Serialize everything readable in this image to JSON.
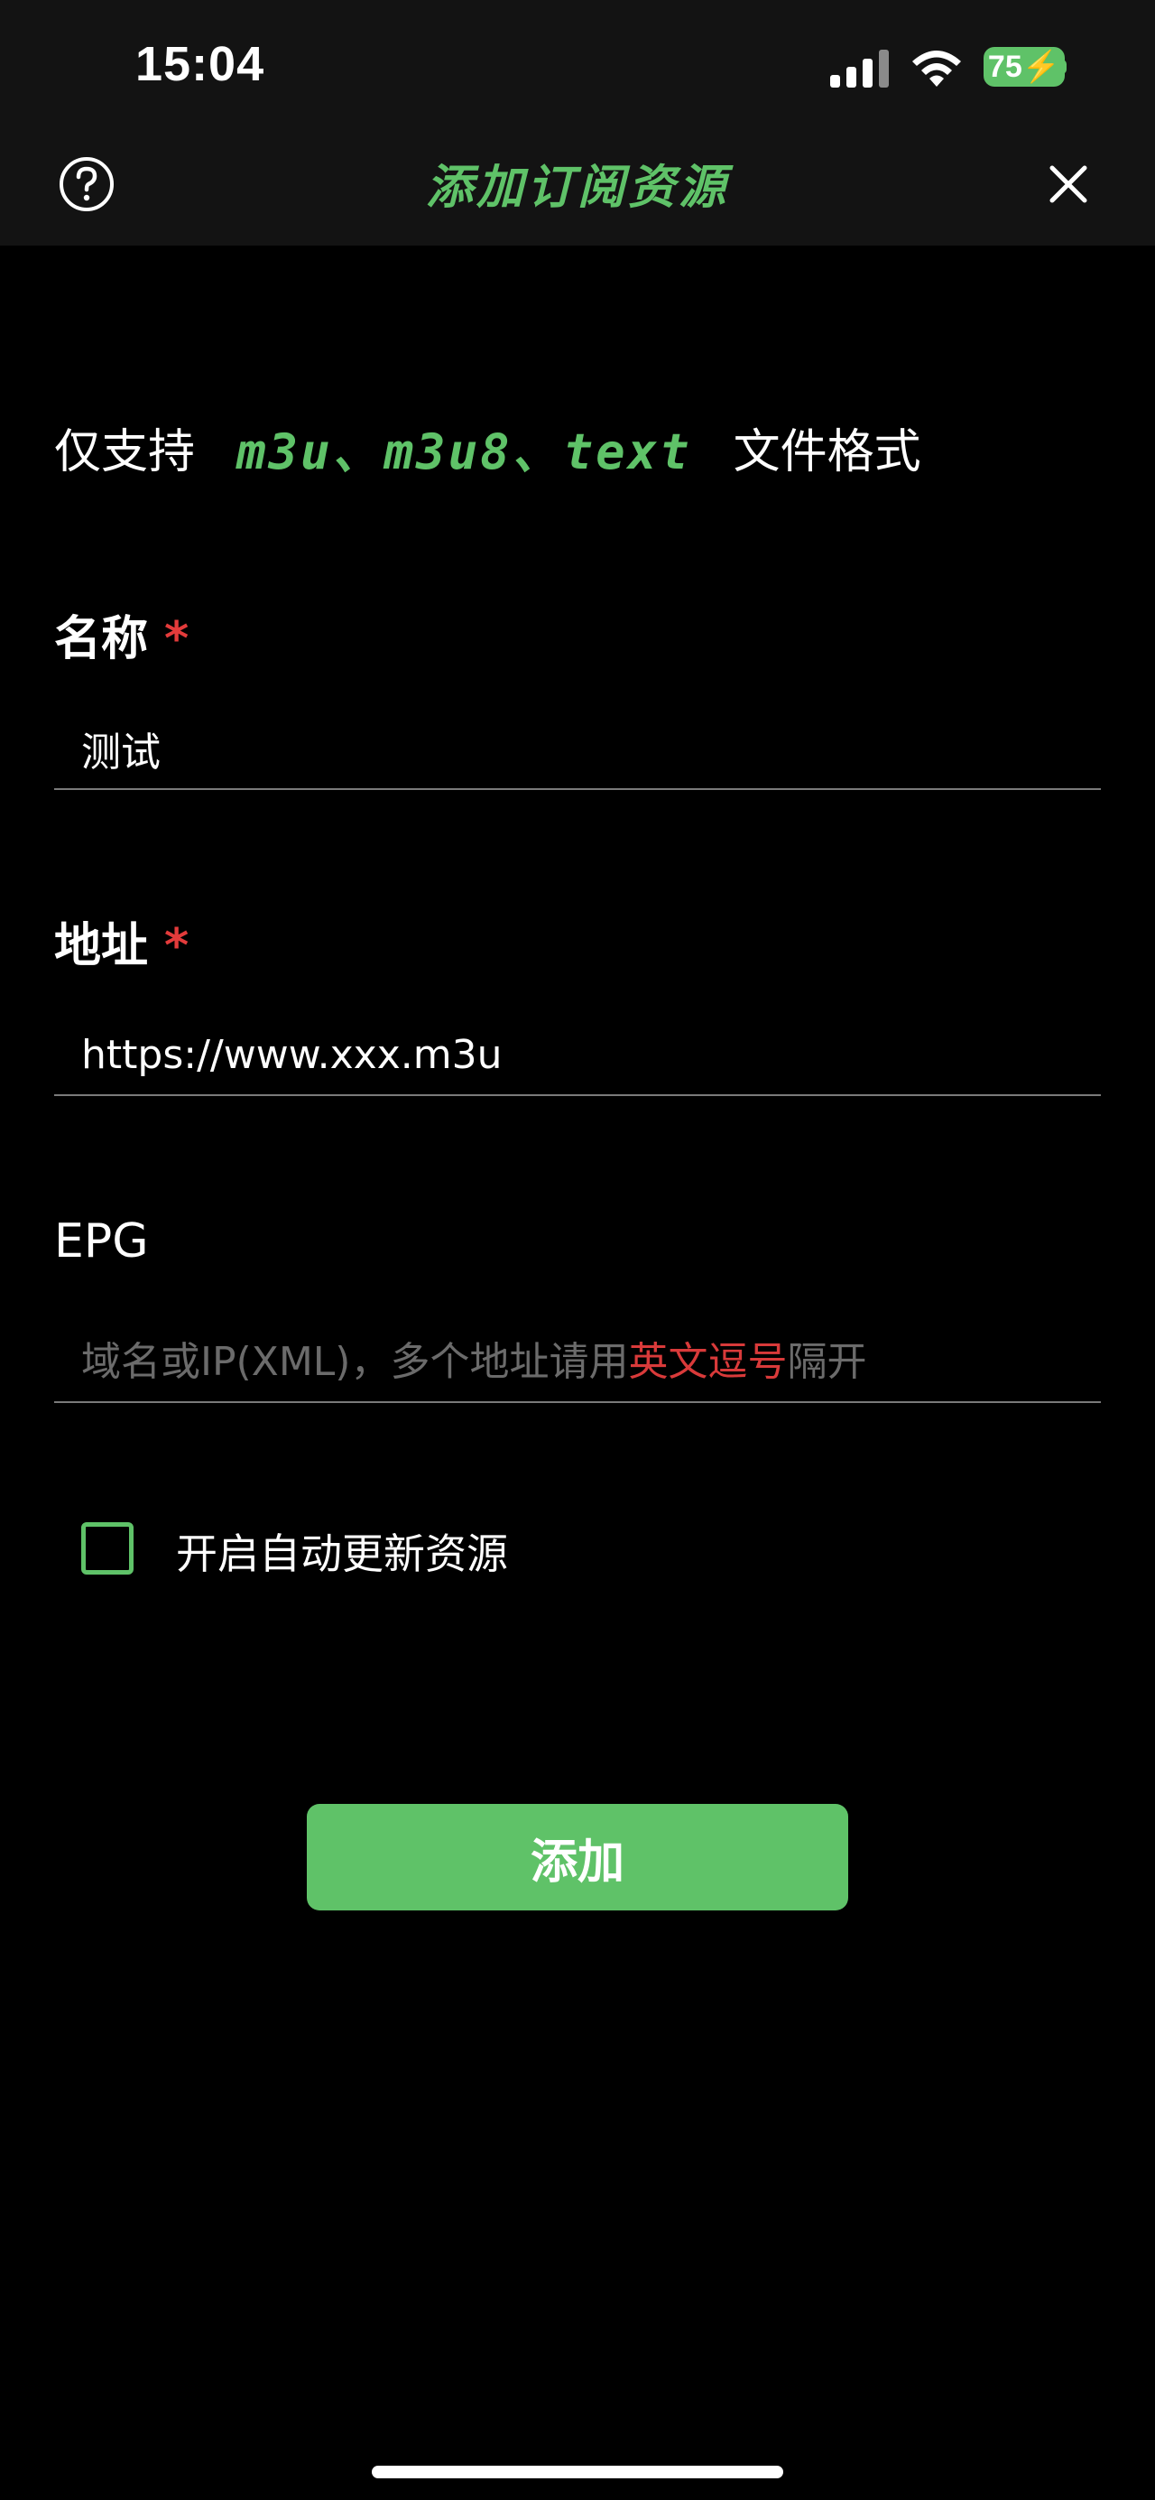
{
  "status_bar": {
    "time": "15:04",
    "battery": "75",
    "icons": [
      "signal-icon",
      "wifi-icon",
      "battery-icon"
    ]
  },
  "header": {
    "title": "添加订阅资源",
    "help_icon": "question-circle-icon",
    "close_icon": "close-icon"
  },
  "notice": {
    "prefix": "仅支持",
    "types": "m3u、m3u8、text",
    "suffix": "文件格式"
  },
  "form": {
    "name": {
      "label": "名称",
      "required_mark": "*",
      "value": "测试"
    },
    "address": {
      "label": "地址",
      "required_mark": "*",
      "value": "https://www.xxx.m3u"
    },
    "epg": {
      "label": "EPG",
      "placeholder_before": "域名或IP(XML)，多个地址请用",
      "placeholder_highlight": "英文逗号",
      "placeholder_after": "隔开"
    },
    "auto_update": {
      "label": "开启自动更新资源",
      "checked": false
    },
    "submit_label": "添加"
  },
  "colors": {
    "accent": "#5fc268",
    "required": "#e33b3b",
    "background": "#000000",
    "header_bg": "#131313"
  }
}
